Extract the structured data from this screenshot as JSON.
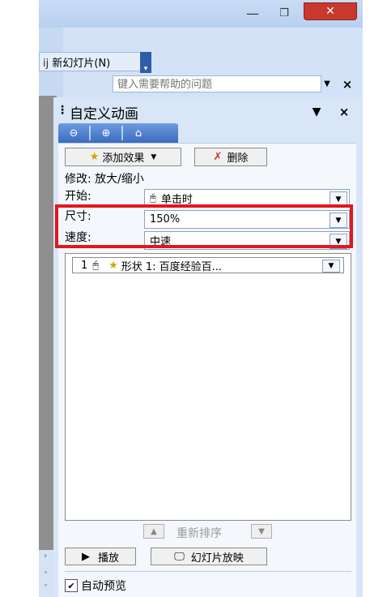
{
  "window": {
    "min_symbol": "—",
    "max_symbol": "❐",
    "close_symbol": "✕"
  },
  "toolbar": {
    "new_slide_label": "新幻灯片(N)",
    "new_slide_prefix": "ij",
    "chevron": "▾"
  },
  "help": {
    "placeholder": "键入需要帮助的问题",
    "drop": "▼",
    "close": "×"
  },
  "pane": {
    "grip": "⋮",
    "title": "自定义动画",
    "drop": "▼",
    "close": "×",
    "nav": {
      "back": "⊖",
      "forward": "⊕",
      "home": "⌂"
    }
  },
  "actions": {
    "add_effect_label": "添加效果",
    "add_effect_arrow": "▼",
    "delete_label": "删除"
  },
  "fields": {
    "modify": "修改: 放大/缩小",
    "start_label": "开始:",
    "start_value": "单击时",
    "size_label": "尺寸:",
    "size_value": "150%",
    "speed_label": "速度:",
    "speed_value": "中速",
    "dropdown_arrow": "▼"
  },
  "list": {
    "items": [
      {
        "index": "1",
        "text": "形状 1: 百度经验百..."
      }
    ]
  },
  "reorder": {
    "label": "重新排序",
    "up": "▲",
    "down": "▼"
  },
  "footer": {
    "play_label": "播放",
    "play_icon": "▶",
    "slideshow_label": "幻灯片放映",
    "auto_preview_label": "自动预览",
    "auto_preview_checked": "✔"
  },
  "scroll": {
    "right_arrow": "›",
    "up_arrow": "˄",
    "down_arrow": "˅"
  },
  "colors": {
    "highlight": "#e3161e",
    "close_button": "#c8392c",
    "nav_bar": "#3a6cc0"
  }
}
